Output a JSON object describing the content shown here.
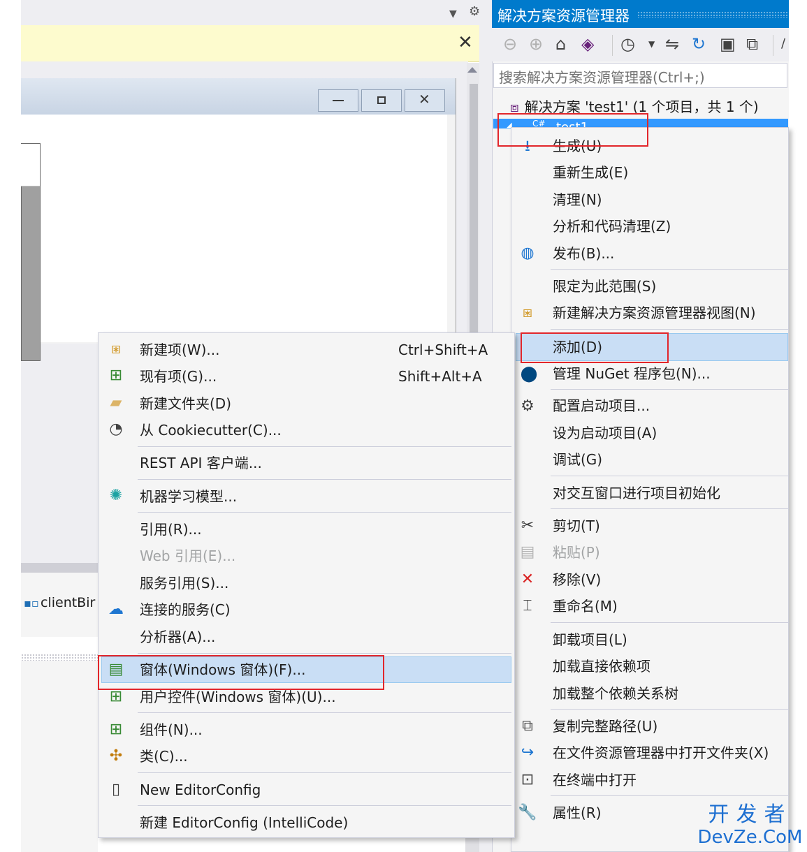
{
  "notification": {
    "close": "✕"
  },
  "tray": {
    "component_label": "clientBir"
  },
  "solution_explorer": {
    "title": "解决方案资源管理器",
    "search_placeholder": "搜索解决方案资源管理器(Ctrl+;)",
    "solution_label": "解决方案 'test1' (1 个项目，共 1 个)",
    "project_label": "test1",
    "project_icon": "C#"
  },
  "project_menu": {
    "build": "生成(U)",
    "rebuild": "重新生成(E)",
    "clean": "清理(N)",
    "analyze": "分析和代码清理(Z)",
    "publish": "发布(B)...",
    "scope": "限定为此范围(S)",
    "new_view": "新建解决方案资源管理器视图(N)",
    "add": "添加(D)",
    "nuget": "管理 NuGet 程序包(N)...",
    "configure_startup": "配置启动项目...",
    "set_startup": "设为启动项目(A)",
    "debug": "调试(G)",
    "interactive": "对交互窗口进行项目初始化",
    "cut": "剪切(T)",
    "paste": "粘贴(P)",
    "remove": "移除(V)",
    "rename": "重命名(M)",
    "unload": "卸载项目(L)",
    "load_direct": "加载直接依赖项",
    "load_tree": "加载整个依赖关系树",
    "copy_path": "复制完整路径(U)",
    "open_folder": "在文件资源管理器中打开文件夹(X)",
    "open_terminal": "在终端中打开",
    "properties": "属性(R)"
  },
  "add_menu": {
    "new_item": "新建项(W)...",
    "new_item_shortcut": "Ctrl+Shift+A",
    "existing_item": "现有项(G)...",
    "existing_item_shortcut": "Shift+Alt+A",
    "new_folder": "新建文件夹(D)",
    "cookiecutter": "从 Cookiecutter(C)...",
    "rest_api": "REST API 客户端...",
    "ml_model": "机器学习模型...",
    "reference": "引用(R)...",
    "web_reference": "Web 引用(E)...",
    "service_reference": "服务引用(S)...",
    "connected_service": "连接的服务(C)",
    "analyzer": "分析器(A)...",
    "form": "窗体(Windows 窗体)(F)...",
    "user_control": "用户控件(Windows 窗体)(U)...",
    "component": "组件(N)...",
    "class": "类(C)...",
    "editorconfig": "New EditorConfig",
    "editorconfig_intellicode": "新建 EditorConfig (IntelliCode)"
  },
  "watermark": {
    "line1": "开发者",
    "line2": "DevZe.CoM"
  },
  "colors": {
    "accent": "#007acc",
    "highlight": "#c9def5",
    "annotation": "#e2262b"
  }
}
